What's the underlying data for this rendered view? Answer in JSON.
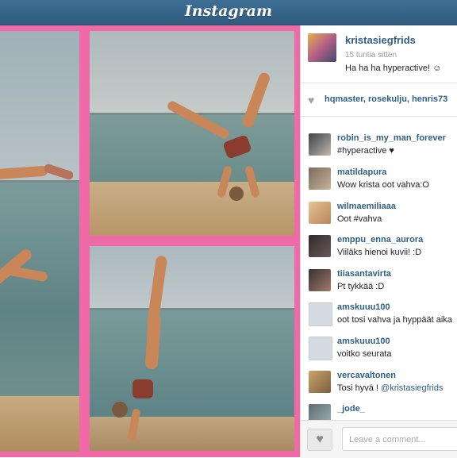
{
  "app": {
    "title": "Instagram"
  },
  "post": {
    "username": "kristasiegfrids",
    "time": "15 tuntia sitten",
    "caption": "Ha ha ha hyperactive! ☺",
    "likers": "hqmaster, rosekulju, henris73"
  },
  "comments": [
    {
      "user": "robin_is_my_man_forever",
      "text": "#hyperactive ♥"
    },
    {
      "user": "matildapura",
      "text": "Wow krista oot vahva:O"
    },
    {
      "user": "wilmaemiliaaa",
      "text": "Oot #vahva"
    },
    {
      "user": "emppu_enna_aurora",
      "text": "Viiläks hienoi kuvii! :D"
    },
    {
      "user": "tiiasantavirta",
      "text": "Pt tykkää :D"
    },
    {
      "user": "amskuuu100",
      "text": "oot tosi vahva ja hyppäät aika"
    },
    {
      "user": "amskuuu100",
      "text": "voitko seurata"
    },
    {
      "user": "vercavaltonen",
      "text": "Tosi hyvä !",
      "mention": "@kristasiegfrids"
    },
    {
      "user": "_jode_",
      "text": ""
    }
  ],
  "comment_input": {
    "placeholder": "Leave a comment..."
  },
  "icons": {
    "like": "heart-icon",
    "like_button": "heart-icon"
  },
  "colors": {
    "topbar": "#3a6688",
    "link": "#2f5f86",
    "frame": "#f06aa8"
  }
}
